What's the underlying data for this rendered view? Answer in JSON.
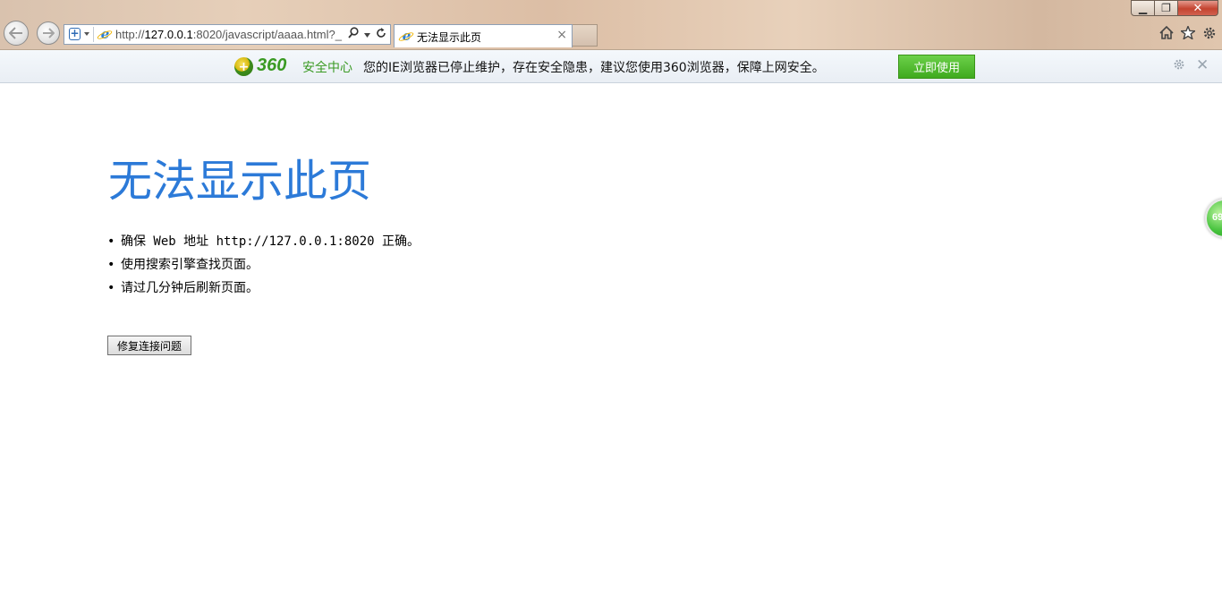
{
  "browser": {
    "url_prefix": "http://",
    "url_host": "127.0.0.1",
    "url_rest": ":8020/javascript/aaaa.html?_",
    "tab_title": "无法显示此页",
    "tab_close": "×",
    "window_controls": {
      "minimize": "▁",
      "maximize": "❐",
      "close": "✕"
    },
    "toolbar_icons": [
      "home-icon",
      "favorites-star-icon",
      "tools-gear-icon"
    ]
  },
  "infobar": {
    "brand": "360",
    "brand_sub": "安全中心",
    "message": "您的IE浏览器已停止维护，存在安全隐患，建议您使用360浏览器，保障上网安全。",
    "button_label": "立即使用",
    "close": "✕",
    "accent": "#3a9a23"
  },
  "page": {
    "title": "无法显示此页",
    "title_color": "#2c7ad8",
    "bullets": [
      "确保 Web 地址 http://127.0.0.1:8020 正确。",
      "使用搜索引擎查找页面。",
      "请过几分钟后刷新页面。"
    ],
    "fix_button": "修复连接问题"
  },
  "floating_ball": {
    "value": "69"
  }
}
